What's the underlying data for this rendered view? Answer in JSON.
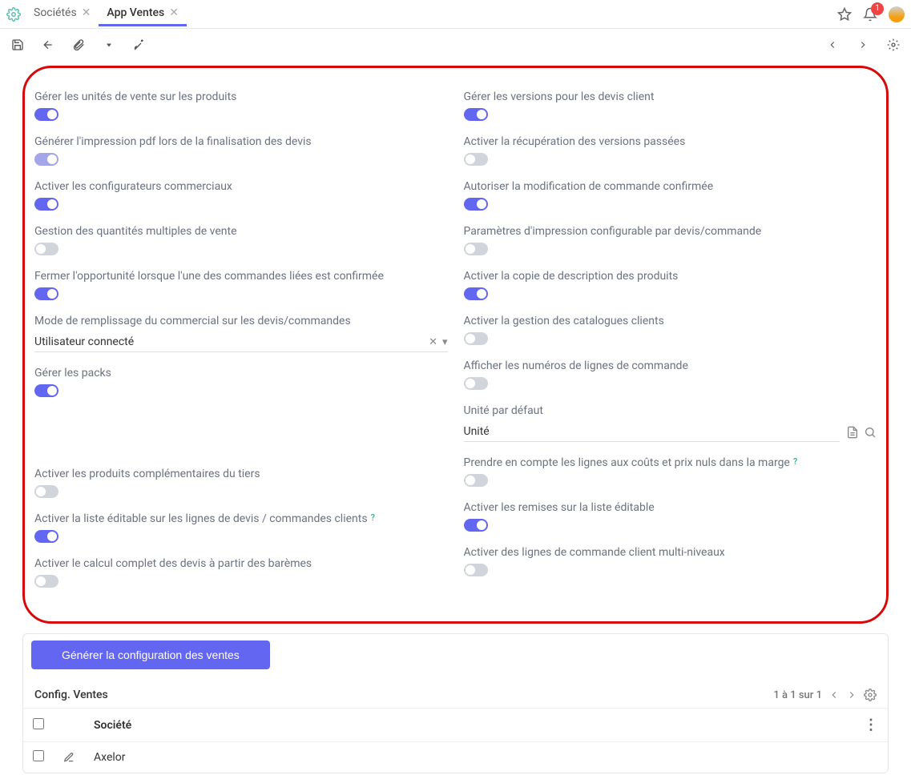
{
  "tabs": [
    {
      "label": "Sociétés"
    },
    {
      "label": "App Ventes"
    }
  ],
  "active_tab": 1,
  "notifications": {
    "count": "1"
  },
  "settings": {
    "left": [
      {
        "label": "Gérer les unités de vente sur les produits",
        "on": true
      },
      {
        "label": "Générer l'impression pdf lors de la finalisation des devis",
        "on": true,
        "dim": true
      },
      {
        "label": "Activer les configurateurs commerciaux",
        "on": true
      },
      {
        "label": "Gestion des quantités multiples de vente",
        "on": false
      },
      {
        "label": "Fermer l'opportunité lorsque l'une des commandes liées est confirmée",
        "on": true
      }
    ],
    "mode_label": "Mode de remplissage du commercial sur les devis/commandes",
    "mode_value": "Utilisateur connecté",
    "left2": [
      {
        "label": "Gérer les packs",
        "on": true
      }
    ],
    "left3": [
      {
        "label": "Activer les produits complémentaires du tiers",
        "on": false
      },
      {
        "label": "Activer la liste éditable sur les lignes de devis / commandes clients",
        "on": true,
        "hint": "?"
      },
      {
        "label": "Activer le calcul complet des devis à partir des barèmes",
        "on": false
      }
    ],
    "right": [
      {
        "label": "Gérer les versions pour les devis client",
        "on": true
      },
      {
        "label": "Activer la récupération des versions passées",
        "on": false
      },
      {
        "label": "Autoriser la modification de commande confirmée",
        "on": true
      },
      {
        "label": "Paramètres d'impression configurable par devis/commande",
        "on": false
      },
      {
        "label": "Activer la copie de description des produits",
        "on": true
      },
      {
        "label": "Activer la gestion des catalogues clients",
        "on": false
      },
      {
        "label": "Afficher les numéros de lignes de commande",
        "on": false
      }
    ],
    "unit_label": "Unité par défaut",
    "unit_value": "Unité",
    "right2": [
      {
        "label": "Prendre en compte les lignes aux coûts et prix nuls dans la marge",
        "on": false,
        "hint": "?"
      },
      {
        "label": "Activer les remises sur la liste éditable",
        "on": true
      },
      {
        "label": "Activer des lignes de commande client multi-niveaux",
        "on": false
      }
    ]
  },
  "generate_button": "Générer la configuration des ventes",
  "config_section": {
    "title": "Config. Ventes",
    "pager": "1 à 1 sur 1",
    "columns": {
      "company": "Société"
    },
    "rows": [
      {
        "company": "Axelor"
      }
    ]
  }
}
